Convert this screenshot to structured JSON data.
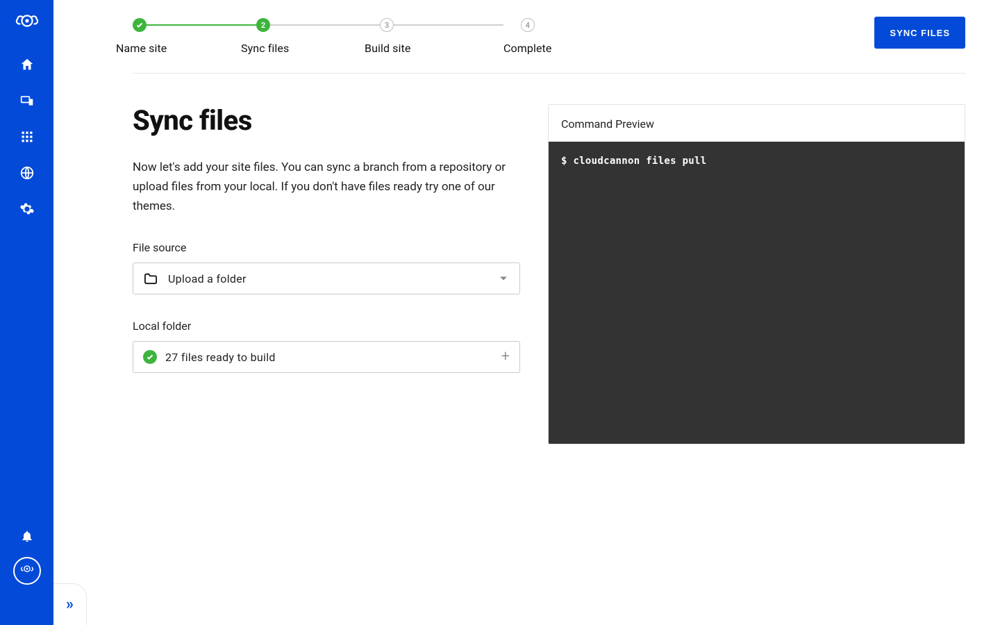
{
  "sidebar": {
    "nav_items": [
      "home",
      "devices",
      "apps",
      "globe",
      "settings"
    ]
  },
  "steps": [
    {
      "label": "Name site",
      "state": "done"
    },
    {
      "label": "Sync files",
      "state": "active",
      "num": "2"
    },
    {
      "label": "Build site",
      "state": "upcoming",
      "num": "3"
    },
    {
      "label": "Complete",
      "state": "upcoming",
      "num": "4"
    }
  ],
  "actions": {
    "sync_files": "SYNC FILES"
  },
  "page": {
    "title": "Sync files",
    "intro": "Now let's add your site files. You can sync a branch from a repository or upload files from your local. If you don't have files ready try one of our themes."
  },
  "form": {
    "file_source_label": "File source",
    "file_source_value": "Upload a folder",
    "local_folder_label": "Local folder",
    "local_folder_status": "27 files ready to build"
  },
  "command": {
    "header": "Command Preview",
    "line": "$ cloudcannon files pull"
  }
}
